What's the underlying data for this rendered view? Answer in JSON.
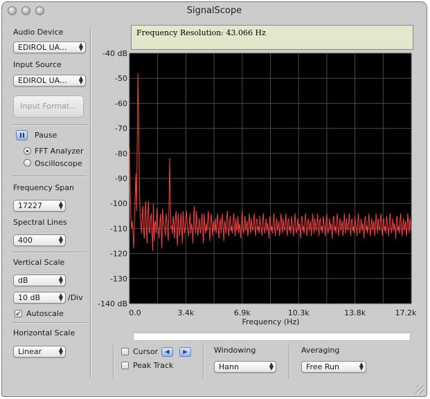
{
  "window": {
    "title": "SignalScope"
  },
  "sidebar": {
    "audio_device_label": "Audio Device",
    "audio_device_value": "EDIROL UA...",
    "input_source_label": "Input Source",
    "input_source_value": "EDIROL UA...",
    "input_format_button": "Input Format...",
    "pause_label": "Pause",
    "mode_fft": "FFT Analyzer",
    "mode_osc": "Oscilloscope",
    "mode_selected": "fft",
    "freq_span_label": "Frequency Span",
    "freq_span_value": "17227",
    "spectral_lines_label": "Spectral Lines",
    "spectral_lines_value": "400",
    "vertical_scale_label": "Vertical Scale",
    "vertical_scale_unit": "dB",
    "per_div_value": "10 dB",
    "per_div_suffix": "/Div",
    "autoscale_label": "Autoscale",
    "autoscale_checked": true,
    "horizontal_scale_label": "Horizontal Scale",
    "horizontal_scale_value": "Linear"
  },
  "info": {
    "text": "Frequency Resolution:  43.066 Hz"
  },
  "bottom": {
    "cursor_label": "Cursor",
    "peak_track_label": "Peak Track",
    "windowing_label": "Windowing",
    "windowing_value": "Hann",
    "averaging_label": "Averaging",
    "averaging_value": "Free Run",
    "progress_fraction": 1.0
  },
  "colors": {
    "trace": "#ff4040",
    "plot_bg": "#000000",
    "grid": "#4a4a4a"
  },
  "chart_data": {
    "type": "line",
    "xlabel": "Frequency (Hz)",
    "ylabel": "",
    "title": "",
    "xlim": [
      0,
      17227
    ],
    "ylim": [
      -140,
      -40
    ],
    "grid": true,
    "x_ticks": [
      0,
      3445,
      6891,
      10336,
      13782,
      17227
    ],
    "x_tick_labels": [
      "0.0",
      "3.4k",
      "6.9k",
      "10.3k",
      "13.8k",
      "17.2k"
    ],
    "y_ticks": [
      -40,
      -50,
      -60,
      -70,
      -80,
      -90,
      -100,
      -110,
      -120,
      -130,
      -140
    ],
    "y_tick_labels": [
      "-40 dB",
      "-50",
      "-60",
      "-70",
      "-80",
      "-90",
      "-100",
      "-110",
      "-120",
      "-130",
      "-140 dB"
    ],
    "series": [
      {
        "x_step": 43.066,
        "values": [
          -78,
          -95,
          -105,
          -110,
          -107,
          -112,
          -118,
          -108,
          -98,
          -88,
          -103,
          -75,
          -48,
          -62,
          -90,
          -104,
          -108,
          -112,
          -106,
          -101,
          -110,
          -114,
          -105,
          -99,
          -110,
          -116,
          -104,
          -99,
          -111,
          -112,
          -106,
          -104,
          -112,
          -119,
          -100,
          -115,
          -108,
          -107,
          -112,
          -102,
          -109,
          -110,
          -114,
          -108,
          -104,
          -111,
          -118,
          -102,
          -106,
          -109,
          -110,
          -113,
          -104,
          -107,
          -111,
          -115,
          -102,
          -82,
          -100,
          -110,
          -109,
          -112,
          -105,
          -108,
          -114,
          -107,
          -103,
          -111,
          -117,
          -104,
          -108,
          -113,
          -110,
          -104,
          -110,
          -116,
          -103,
          -107,
          -112,
          -110,
          -106,
          -103,
          -109,
          -111,
          -113,
          -107,
          -104,
          -112,
          -108,
          -110,
          -116,
          -105,
          -101,
          -109,
          -112,
          -103,
          -108,
          -113,
          -110,
          -106,
          -110,
          -112,
          -107,
          -104,
          -111,
          -116,
          -104,
          -109,
          -112,
          -108,
          -111,
          -106,
          -103,
          -110,
          -115,
          -109,
          -104,
          -108,
          -113,
          -107,
          -110,
          -111,
          -106,
          -112,
          -108,
          -104,
          -110,
          -114,
          -109,
          -106,
          -112,
          -108,
          -104,
          -110,
          -115,
          -107,
          -109,
          -112,
          -106,
          -103,
          -110,
          -113,
          -108,
          -105,
          -111,
          -109,
          -112,
          -107,
          -104,
          -110,
          -113,
          -106,
          -111,
          -109,
          -105,
          -112,
          -108,
          -110,
          -114,
          -106,
          -103,
          -110,
          -112,
          -108,
          -105,
          -111,
          -109,
          -107,
          -113,
          -110,
          -104,
          -108,
          -112,
          -106,
          -109,
          -111,
          -108,
          -104,
          -110,
          -113,
          -107,
          -106,
          -111,
          -109,
          -112,
          -105,
          -108,
          -110,
          -113,
          -107,
          -104,
          -110,
          -112,
          -109,
          -106,
          -111,
          -108,
          -110,
          -114,
          -106,
          -105,
          -111,
          -109,
          -112,
          -107,
          -104,
          -110,
          -113,
          -108,
          -106,
          -111,
          -109,
          -107,
          -113,
          -110,
          -104,
          -108,
          -112,
          -106,
          -109,
          -111,
          -108,
          -104,
          -110,
          -113,
          -107,
          -106,
          -111,
          -109,
          -112,
          -105,
          -108,
          -110,
          -113,
          -107,
          -104,
          -110,
          -112,
          -109,
          -106,
          -111,
          -108,
          -110,
          -114,
          -106,
          -105,
          -111,
          -109,
          -112,
          -107,
          -104,
          -110,
          -113,
          -108,
          -106,
          -111,
          -109,
          -107,
          -113,
          -110,
          -104,
          -108,
          -112,
          -106,
          -109,
          -111,
          -108,
          -104,
          -110,
          -113,
          -107,
          -106,
          -111,
          -109,
          -112,
          -105,
          -108,
          -110,
          -113,
          -107,
          -104,
          -110,
          -112,
          -109,
          -106,
          -111,
          -108,
          -110,
          -114,
          -106,
          -105,
          -111,
          -109,
          -112,
          -107,
          -104,
          -110,
          -113,
          -108,
          -106,
          -111,
          -109,
          -107,
          -113,
          -110,
          -104,
          -108,
          -112,
          -106,
          -109,
          -111,
          -108,
          -104,
          -110,
          -113,
          -107,
          -106,
          -111,
          -109,
          -112,
          -105,
          -108,
          -110,
          -113,
          -107,
          -104,
          -110,
          -112,
          -109,
          -106,
          -111,
          -108,
          -110,
          -114,
          -106,
          -105,
          -111,
          -109,
          -112,
          -107,
          -104,
          -110,
          -113,
          -108,
          -106,
          -111,
          -109,
          -107,
          -113,
          -110,
          -104,
          -108,
          -112,
          -106,
          -109,
          -111,
          -108,
          -104,
          -110,
          -113,
          -107,
          -106,
          -111,
          -109,
          -112,
          -105,
          -108,
          -110,
          -113,
          -107,
          -104,
          -110,
          -112,
          -109,
          -106,
          -111,
          -108,
          -110,
          -114,
          -106,
          -105,
          -111,
          -109,
          -112,
          -107,
          -104,
          -110,
          -113,
          -108,
          -106,
          -111,
          -109,
          -107,
          -113,
          -110,
          -104,
          -108,
          -112,
          -106,
          -109,
          -111,
          -108,
          -104,
          -110,
          -113,
          -107,
          -106,
          -111,
          -109,
          -112,
          -105,
          -108,
          -110,
          -113,
          -107,
          -104,
          -110
        ]
      }
    ]
  }
}
